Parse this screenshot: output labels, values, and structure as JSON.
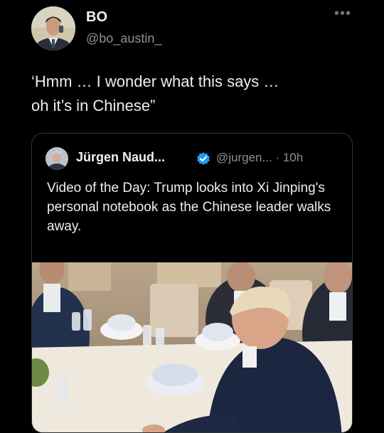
{
  "author": {
    "name": "BO",
    "handle": "@bo_austin_"
  },
  "tweet": {
    "text_line1": "‘Hmm … I wonder what this says …",
    "text_line2": "oh it’s in Chinese”"
  },
  "quoted": {
    "name": "Jürgen Naud...",
    "handle": "@jurgen...",
    "separator": "·",
    "time": "10h",
    "text": "Video of the Day: Trump looks into Xi Jinping's personal notebook as the Chinese leader walks away."
  },
  "icons": {
    "more": "more-horizontal-icon",
    "verified": "verified-badge-icon"
  },
  "colors": {
    "background": "#000000",
    "verified": "#1d9bf0",
    "secondary_text": "#8b9096"
  }
}
